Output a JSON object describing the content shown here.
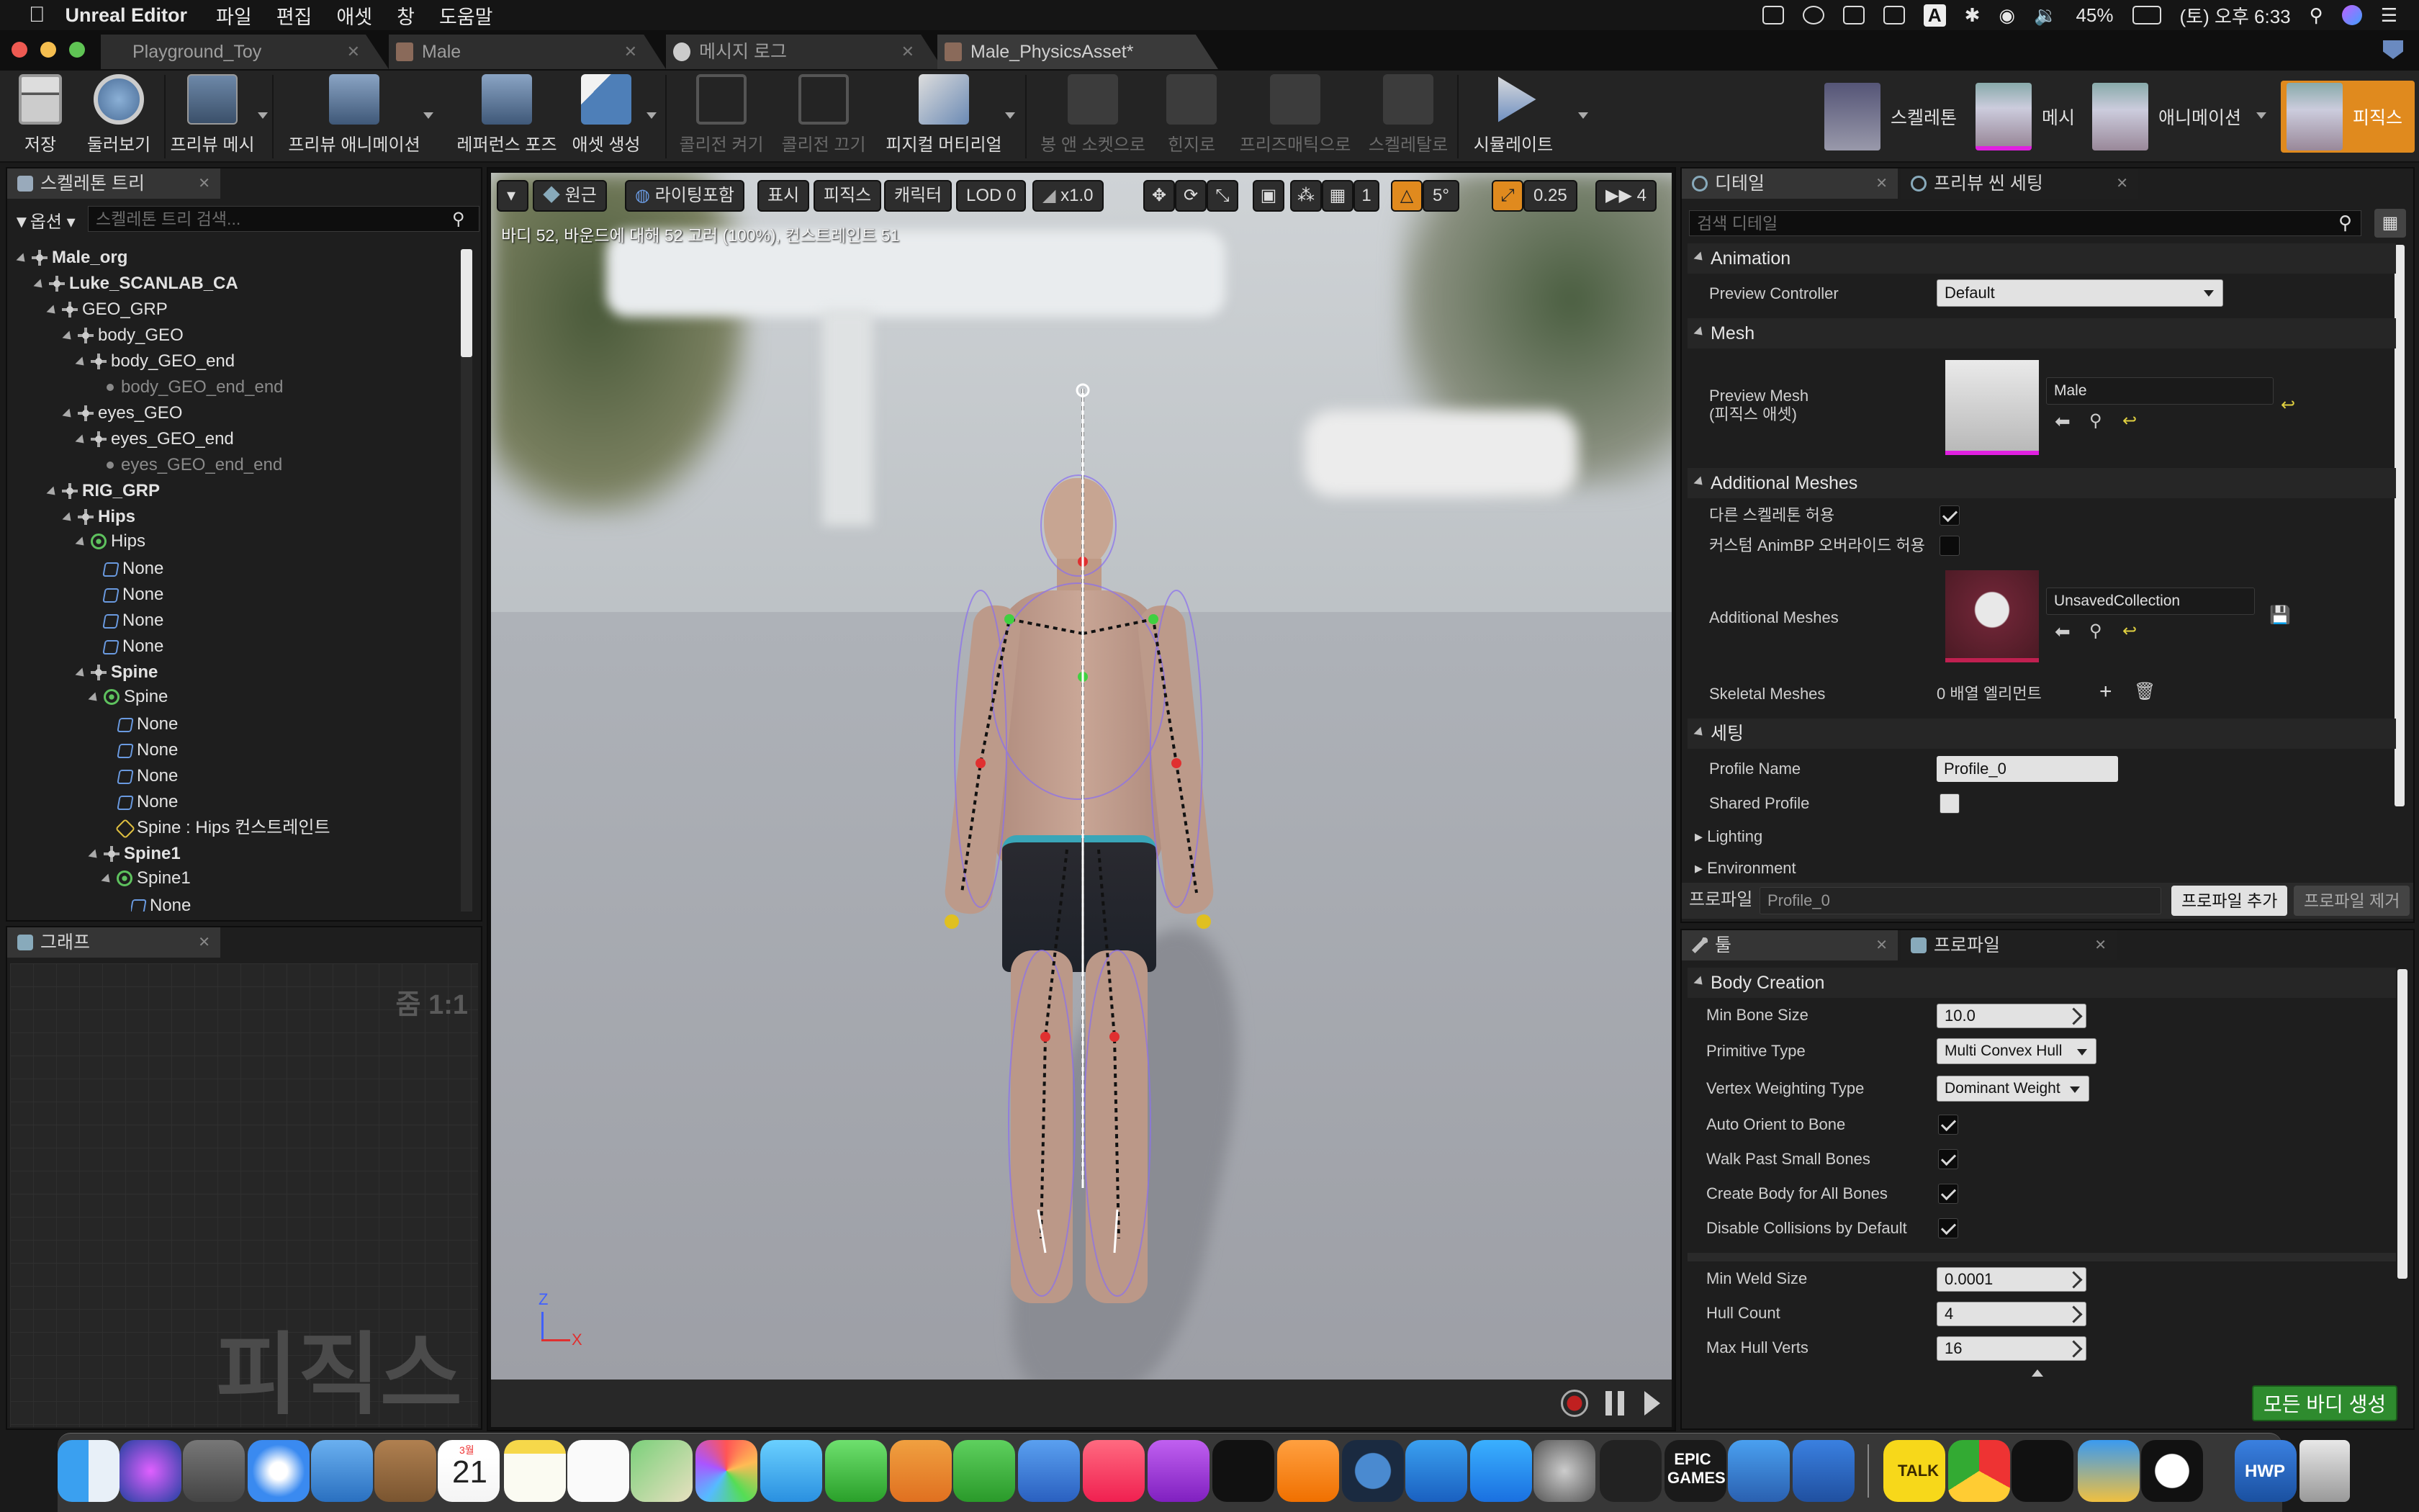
{
  "menubar": {
    "app_name": "Unreal Editor",
    "items": [
      "파일",
      "편집",
      "애셋",
      "창",
      "도움말"
    ],
    "battery": "45%",
    "datetime": "(토) 오후 6:33"
  },
  "document_tabs": [
    "Playground_Toy",
    "Male",
    "메시지 로그",
    "Male_PhysicsAsset*"
  ],
  "toolbar": {
    "buttons": [
      {
        "label": "저장",
        "enabled": true
      },
      {
        "label": "둘러보기",
        "enabled": true
      },
      {
        "label": "프리뷰 메시",
        "enabled": true
      },
      {
        "label": "프리뷰 애니메이션",
        "enabled": true
      },
      {
        "label": "레퍼런스 포즈",
        "enabled": true
      },
      {
        "label": "애셋 생성",
        "enabled": true
      },
      {
        "label": "콜리전 켜기",
        "enabled": false
      },
      {
        "label": "콜리전 끄기",
        "enabled": false
      },
      {
        "label": "피지컬 머티리얼",
        "enabled": true
      },
      {
        "label": "봉 앤 소켓으로",
        "enabled": false
      },
      {
        "label": "힌지로",
        "enabled": false
      },
      {
        "label": "프리즈매틱으로",
        "enabled": false
      },
      {
        "label": "스켈레탈로",
        "enabled": false
      },
      {
        "label": "시뮬레이트",
        "enabled": true
      }
    ],
    "modes": [
      "스켈레톤",
      "메시",
      "애니메이션",
      "피직스"
    ]
  },
  "skeleton_tree": {
    "tab": "스켈레톤 트리",
    "options_label": "옵션",
    "search_placeholder": "스켈레톤 트리 검색...",
    "rows": [
      {
        "label": "Male_org",
        "bold": true
      },
      {
        "label": "Luke_SCANLAB_CA",
        "bold": true
      },
      {
        "label": "GEO_GRP",
        "bold": false
      },
      {
        "label": "body_GEO",
        "bold": false
      },
      {
        "label": "body_GEO_end",
        "bold": false
      },
      {
        "label": "body_GEO_end_end",
        "bold": false
      },
      {
        "label": "eyes_GEO",
        "bold": false
      },
      {
        "label": "eyes_GEO_end",
        "bold": false
      },
      {
        "label": "eyes_GEO_end_end",
        "bold": false
      },
      {
        "label": "RIG_GRP",
        "bold": true
      },
      {
        "label": "Hips",
        "bold": true
      },
      {
        "label": "Hips",
        "bold": false
      },
      {
        "label": "None",
        "bold": false
      },
      {
        "label": "None",
        "bold": false
      },
      {
        "label": "None",
        "bold": false
      },
      {
        "label": "None",
        "bold": false
      },
      {
        "label": "Spine",
        "bold": true
      },
      {
        "label": "Spine",
        "bold": false
      },
      {
        "label": "None",
        "bold": false
      },
      {
        "label": "None",
        "bold": false
      },
      {
        "label": "None",
        "bold": false
      },
      {
        "label": "None",
        "bold": false
      },
      {
        "label": "Spine : Hips 컨스트레인트",
        "bold": false
      },
      {
        "label": "Spine1",
        "bold": true
      },
      {
        "label": "Spine1",
        "bold": false
      },
      {
        "label": "None",
        "bold": false
      }
    ]
  },
  "graph": {
    "tab": "그래프",
    "zoom": "줌 1:1",
    "watermark": "피직스"
  },
  "viewport": {
    "buttons": [
      "원근",
      "라이팅포함",
      "표시",
      "피직스",
      "캐릭터",
      "LOD 0",
      "x1.0"
    ],
    "snap_angle": "5°",
    "snap_scale": "0.25",
    "camera_speed": "4",
    "info": "바디 52, 바운드에 대해 52 고러 (100%), 컨스트레인트 51",
    "axis_z": "Z",
    "axis_x": "X"
  },
  "details": {
    "tab_details": "디테일",
    "tab_preview": "프리뷰 씬 세팅",
    "search_placeholder": "검색 디테일",
    "sections": {
      "animation": "Animation",
      "mesh": "Mesh",
      "additional": "Additional Meshes",
      "settings": "세팅"
    },
    "preview_controller_label": "Preview Controller",
    "preview_controller_value": "Default",
    "preview_mesh_label": "Preview Mesh",
    "preview_mesh_sub": "(피직스 애셋)",
    "preview_mesh_value": "Male",
    "allow_other_skel": "다른 스켈레톤 허용",
    "custom_animbp": "커스텀 AnimBP 오버라이드 허용",
    "additional_meshes_label": "Additional Meshes",
    "additional_meshes_value": "UnsavedCollection",
    "skeletal_meshes_label": "Skeletal Meshes",
    "skeletal_meshes_value": "0 배열 엘리먼트",
    "profile_name_label": "Profile Name",
    "profile_name_value": "Profile_0",
    "shared_profile_label": "Shared Profile",
    "lighting": "Lighting",
    "environment": "Environment",
    "profile_label": "프로파일",
    "profile_value": "Profile_0",
    "add_profile": "프로파일 추가",
    "remove_profile": "프로파일 제거"
  },
  "tools": {
    "tab_tools": "툴",
    "tab_profile": "프로파일",
    "section": "Body Creation",
    "fields": [
      {
        "label": "Min Bone Size",
        "value": "10.0"
      },
      {
        "label": "Primitive Type",
        "value": "Multi Convex Hull"
      },
      {
        "label": "Vertex Weighting Type",
        "value": "Dominant Weight"
      }
    ],
    "checks": [
      {
        "label": "Auto Orient to Bone",
        "checked": true
      },
      {
        "label": "Walk Past Small Bones",
        "checked": true
      },
      {
        "label": "Create Body for All Bones",
        "checked": true
      },
      {
        "label": "Disable Collisions by Default",
        "checked": true
      }
    ],
    "numbers": [
      {
        "label": "Min Weld Size",
        "value": "0.0001"
      },
      {
        "label": "Hull Count",
        "value": "4"
      },
      {
        "label": "Max Hull Verts",
        "value": "16"
      }
    ],
    "generate_button": "모든 바디 생성"
  },
  "colors": {
    "accent_orange": "#e08a1e",
    "green_button": "#2e8b2e"
  },
  "dock": {
    "calendar_day": "21",
    "calendar_month": "3월",
    "hwp_label": "HWP",
    "talk_label": "TALK",
    "epic_label": "EPIC GAMES"
  }
}
